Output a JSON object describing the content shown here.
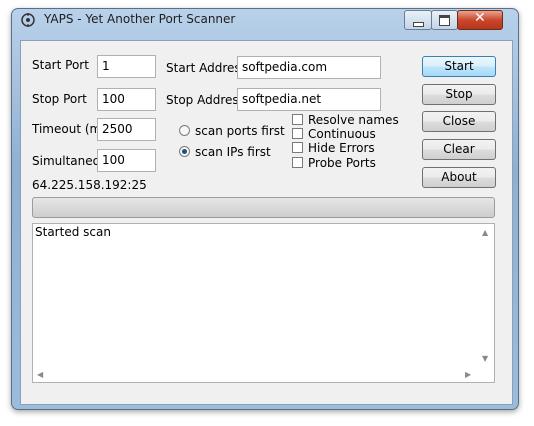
{
  "window": {
    "title": "YAPS - Yet Another Port Scanner"
  },
  "form": {
    "start_port": {
      "label": "Start Port",
      "value": "1"
    },
    "stop_port": {
      "label": "Stop Port",
      "value": "100"
    },
    "timeout": {
      "label": "Timeout (ms)",
      "value": "2500"
    },
    "simultaneous": {
      "label": "Simultaneous",
      "value": "100"
    },
    "start_address": {
      "label": "Start Address",
      "value": "softpedia.com"
    },
    "stop_address": {
      "label": "Stop Address",
      "value": "softpedia.net"
    },
    "scan_ports_first": {
      "label": "scan ports first",
      "selected": false
    },
    "scan_ips_first": {
      "label": "scan IPs first",
      "selected": true
    },
    "resolve_names": {
      "label": "Resolve names",
      "checked": false
    },
    "continuous": {
      "label": "Continuous",
      "checked": false
    },
    "hide_errors": {
      "label": "Hide Errors",
      "checked": false
    },
    "probe_ports": {
      "label": "Probe Ports",
      "checked": false
    }
  },
  "buttons": {
    "start": "Start",
    "stop": "Stop",
    "close": "Close",
    "clear": "Clear",
    "about": "About"
  },
  "status": {
    "current_target": "64.225.158.192:25",
    "progress": 0
  },
  "log": {
    "lines": [
      "Started scan"
    ]
  },
  "icons": {
    "app": "app-scanner-icon",
    "minimize": "minimize-icon",
    "maximize": "maximize-icon",
    "close": "close-icon"
  },
  "colors": {
    "titlebar": "#b9d1ea",
    "client_bg": "#f0f0f0",
    "close_button": "#c9472b",
    "default_button": "#bee6fd"
  }
}
